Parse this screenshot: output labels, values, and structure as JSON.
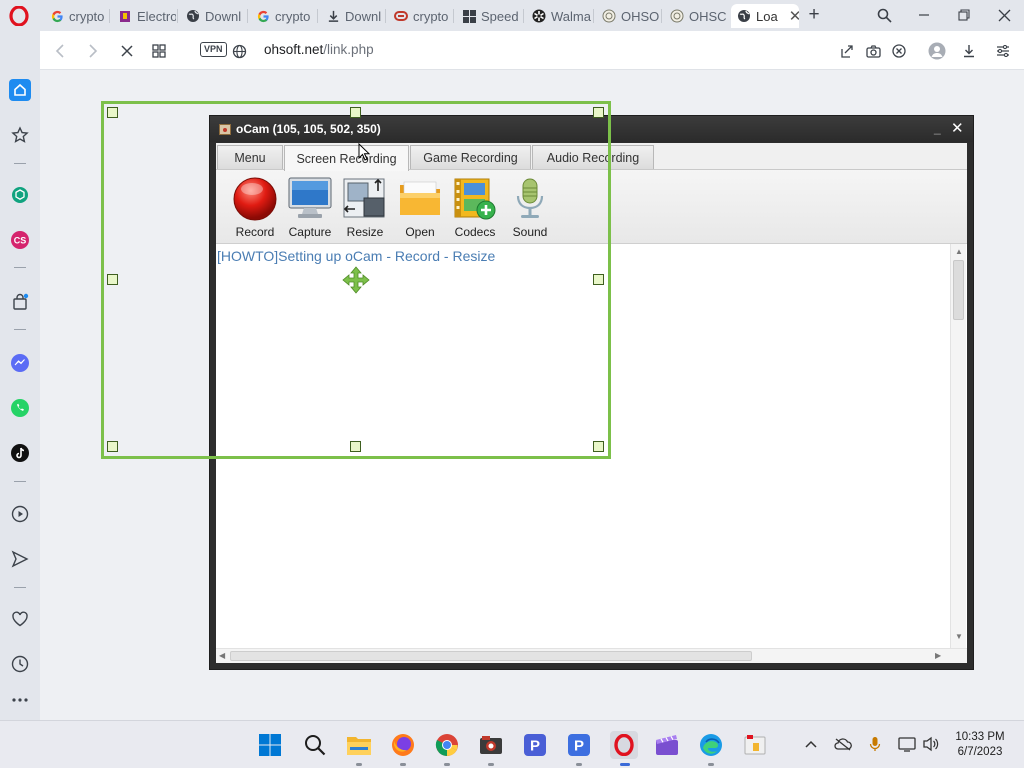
{
  "browser": {
    "tabs": [
      {
        "title": "crypto",
        "icon": "google-icon"
      },
      {
        "title": "Electro",
        "icon": "bookmark-icon"
      },
      {
        "title": "Downl",
        "icon": "globe-icon"
      },
      {
        "title": "crypto",
        "icon": "google-icon"
      },
      {
        "title": "Downl",
        "icon": "download-icon"
      },
      {
        "title": "crypto",
        "icon": "link-icon"
      },
      {
        "title": "Speed",
        "icon": "grid-icon"
      },
      {
        "title": "Walma",
        "icon": "walmart-icon"
      },
      {
        "title": "OHSO",
        "icon": "ohsoft-icon"
      },
      {
        "title": "OHSC",
        "icon": "ohsoft-icon"
      },
      {
        "title": "Loa",
        "icon": "globe-icon",
        "active": true
      }
    ],
    "new_tab": "+",
    "address": {
      "vpn_label": "VPN",
      "domain": "ohsoft.net",
      "path": "/link.php"
    }
  },
  "ocam": {
    "title": "oCam (105, 105, 502, 350)",
    "tabs": [
      "Menu",
      "Screen Recording",
      "Game Recording",
      "Audio Recording"
    ],
    "active_tab": "Screen Recording",
    "tools": [
      {
        "label": "Record",
        "icon": "record-icon"
      },
      {
        "label": "Capture",
        "icon": "monitor-icon"
      },
      {
        "label": "Resize",
        "icon": "resize-icon"
      },
      {
        "label": "Open",
        "icon": "folder-icon"
      },
      {
        "label": "Codecs",
        "icon": "codecs-icon"
      },
      {
        "label": "Sound",
        "icon": "microphone-icon"
      }
    ],
    "content_link": "[HOWTO]Setting up oCam - Record - Resize"
  },
  "taskbar": {
    "clock": {
      "time": "10:33 PM",
      "date": "6/7/2023"
    }
  },
  "colors": {
    "capture_frame": "#7cc04a",
    "opera_red": "#e0121f",
    "link": "#4a7db3"
  }
}
